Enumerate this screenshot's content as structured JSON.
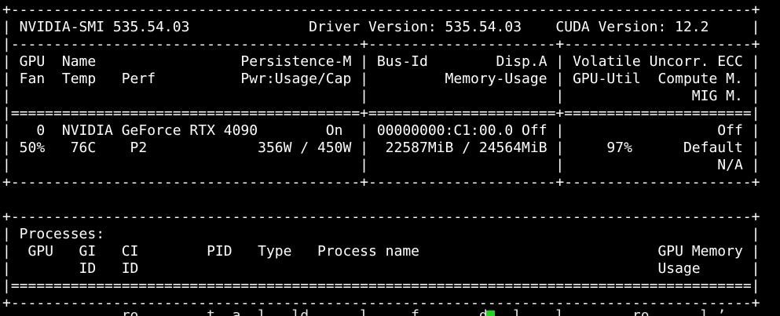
{
  "terminal": {
    "lines": [
      "+---------------------------------------------------------------------------------------+",
      "| NVIDIA-SMI 535.54.03              Driver Version: 535.54.03    CUDA Version: 12.2     |",
      "|-----------------------------------------+----------------------+----------------------+",
      "| GPU  Name                 Persistence-M | Bus-Id        Disp.A | Volatile Uncorr. ECC |",
      "| Fan  Temp   Perf          Pwr:Usage/Cap |         Memory-Usage | GPU-Util  Compute M. |",
      "|                                         |                      |               MIG M. |",
      "|=========================================+======================+======================|",
      "|   0  NVIDIA GeForce RTX 4090        On  | 00000000:C1:00.0 Off |                  Off |",
      "| 50%   76C    P2             356W / 450W |  22587MiB / 24564MiB |     97%      Default |",
      "|                                         |                      |                  N/A |",
      "+-----------------------------------------+----------------------+----------------------+",
      "",
      "+---------------------------------------------------------------------------------------+",
      "| Processes:                                                                            |",
      "|  GPU   GI   CI        PID   Type   Process name                            GPU Memory |",
      "|        ID   ID                                                             Usage      |",
      "|=======================================================================================|",
      "+---------------------------------------------------------------------------------------+"
    ],
    "cut_line": "              ro        t  a  l   ld      l     f       d   l    l        ro      l ’"
  },
  "colors": {
    "background": "#000000",
    "text": "#ffffff",
    "cursor": "#1fd61f"
  }
}
